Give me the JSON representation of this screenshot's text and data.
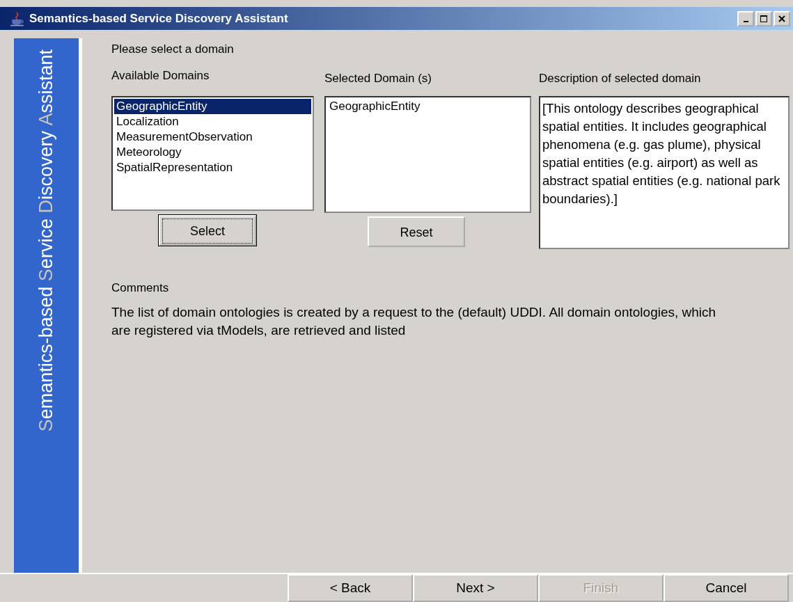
{
  "window": {
    "title": "Semantics-based Service Discovery Assistant"
  },
  "sidebar": {
    "title": "Semantics-based Service Discovery Assistant"
  },
  "prompt": "Please select a domain",
  "available": {
    "label": "Available Domains",
    "items": [
      {
        "label": "GeographicEntity",
        "selected": true
      },
      {
        "label": "Localization",
        "selected": false
      },
      {
        "label": "MeasurementObservation",
        "selected": false
      },
      {
        "label": "Meteorology",
        "selected": false
      },
      {
        "label": "SpatialRepresentation",
        "selected": false
      }
    ],
    "button": {
      "label": "Select",
      "focused": true
    }
  },
  "chosen": {
    "label": "Selected Domain (s)",
    "items": [
      {
        "label": "GeographicEntity",
        "selected": false
      }
    ],
    "button": {
      "label": "Reset",
      "focused": false
    }
  },
  "description": {
    "label": "Description of selected domain",
    "value": "[This ontology describes geographical spatial entities. It includes geographical phenomena (e.g. gas plume), physical spatial entities (e.g. airport) as well as abstract spatial entities (e.g. national park boundaries).]"
  },
  "comments": {
    "label": "Comments",
    "text": "The list of domain ontologies is created by a request to the (default) UDDI. All domain ontologies, which are registered via tModels, are retrieved and listed"
  },
  "buttons": [
    {
      "label": "< Back",
      "disabled": false
    },
    {
      "label": "Next >",
      "disabled": false
    },
    {
      "label": "Finish",
      "disabled": true
    },
    {
      "label": "Cancel",
      "disabled": false
    }
  ]
}
